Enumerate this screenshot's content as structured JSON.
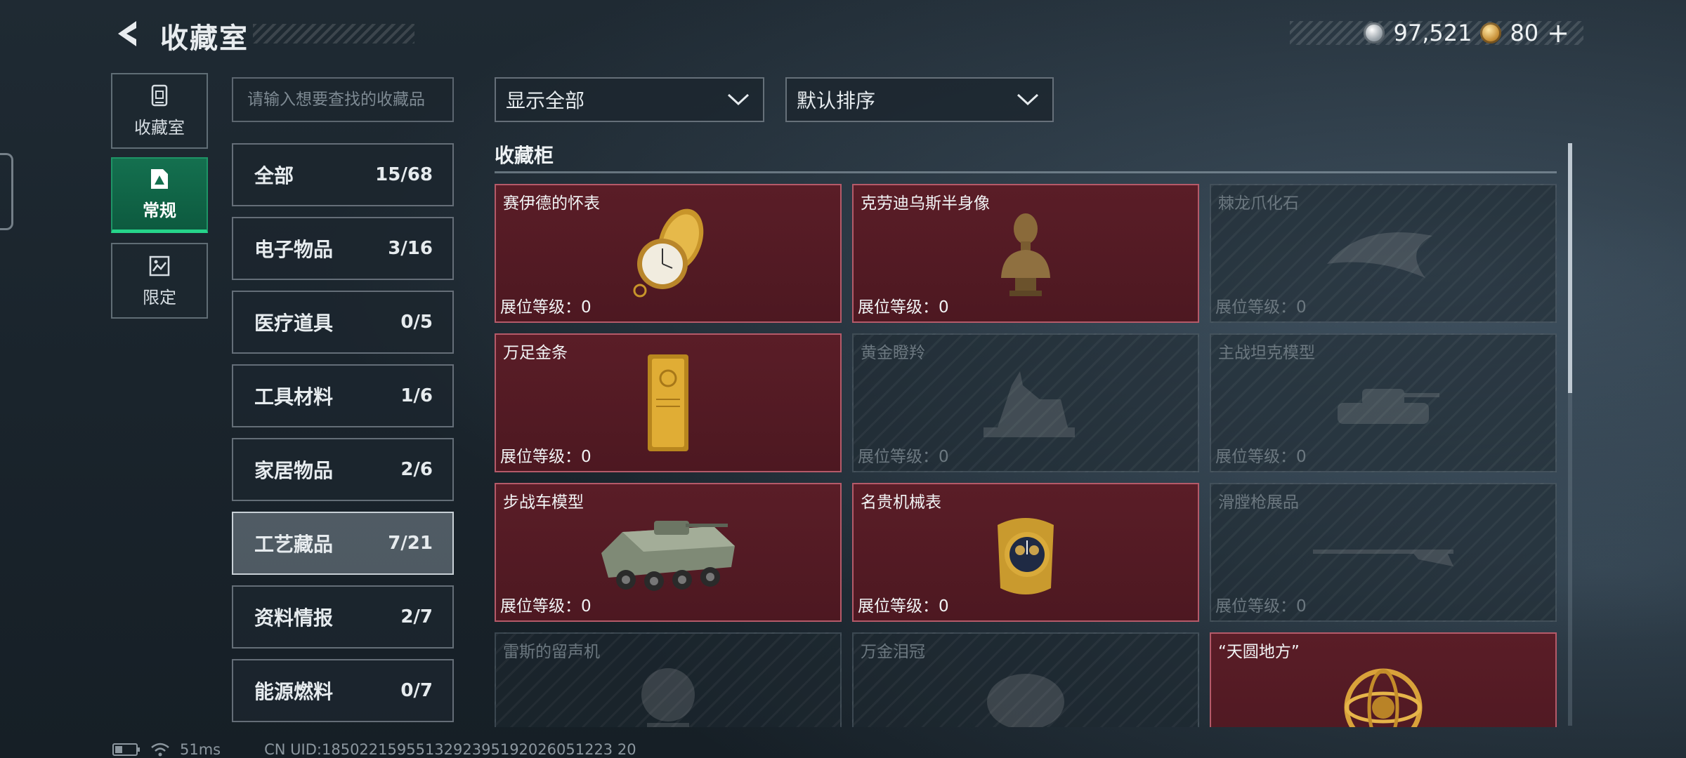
{
  "header": {
    "title": "收藏室"
  },
  "currency": [
    {
      "name": "silver-coin-icon",
      "value": "97,521"
    },
    {
      "name": "gold-coin-icon",
      "value": "80"
    }
  ],
  "side_tabs": [
    {
      "label": "收藏室",
      "icon": "collection-room-icon",
      "active": false
    },
    {
      "label": "常规",
      "icon": "regular-icon",
      "active": true
    },
    {
      "label": "限定",
      "icon": "limited-icon",
      "active": false
    }
  ],
  "search": {
    "placeholder": "请输入想要查找的收藏品",
    "value": ""
  },
  "categories": [
    {
      "name": "全部",
      "count": "15/68"
    },
    {
      "name": "电子物品",
      "count": "3/16"
    },
    {
      "name": "医疗道具",
      "count": "0/5"
    },
    {
      "name": "工具材料",
      "count": "1/6"
    },
    {
      "name": "家居物品",
      "count": "2/6"
    },
    {
      "name": "工艺藏品",
      "count": "7/21",
      "active": true
    },
    {
      "name": "资料情报",
      "count": "2/7"
    },
    {
      "name": "能源燃料",
      "count": "0/7"
    }
  ],
  "filters": {
    "show": "显示全部",
    "sort": "默认排序"
  },
  "cabinet": {
    "title": "收藏柜",
    "items": [
      {
        "name": "赛伊德的怀表",
        "level": "展位等级：0",
        "unlocked": true,
        "icon": "pocket-watch-icon"
      },
      {
        "name": "克劳迪乌斯半身像",
        "level": "展位等级：0",
        "unlocked": true,
        "icon": "bust-statue-icon"
      },
      {
        "name": "棘龙爪化石",
        "level": "展位等级：0",
        "unlocked": false,
        "icon": "claw-fossil-icon"
      },
      {
        "name": "万足金条",
        "level": "展位等级：0",
        "unlocked": true,
        "icon": "gold-bar-icon"
      },
      {
        "name": "黄金瞪羚",
        "level": "展位等级：0",
        "unlocked": false,
        "icon": "gazelle-statue-icon"
      },
      {
        "name": "主战坦克模型",
        "level": "展位等级：0",
        "unlocked": false,
        "icon": "tank-model-icon"
      },
      {
        "name": "步战车模型",
        "level": "展位等级：0",
        "unlocked": true,
        "icon": "ifv-model-icon"
      },
      {
        "name": "名贵机械表",
        "level": "展位等级：0",
        "unlocked": true,
        "icon": "wristwatch-icon"
      },
      {
        "name": "滑膛枪展品",
        "level": "展位等级：0",
        "unlocked": false,
        "icon": "musket-icon"
      },
      {
        "name": "雷斯的留声机",
        "level": "",
        "unlocked": false,
        "icon": "gramophone-icon"
      },
      {
        "name": "万金泪冠",
        "level": "",
        "unlocked": false,
        "icon": "crown-icon"
      },
      {
        "name": "“天圆地方”",
        "level": "",
        "unlocked": true,
        "icon": "armillary-sphere-icon"
      }
    ]
  },
  "status": {
    "ping": "51ms",
    "uid": "CN UID:1850221595513292395192026051223 20"
  },
  "colors": {
    "accent_green": "#14704f",
    "card_unlocked": "#5a1d27",
    "card_border": "#b55a69"
  }
}
